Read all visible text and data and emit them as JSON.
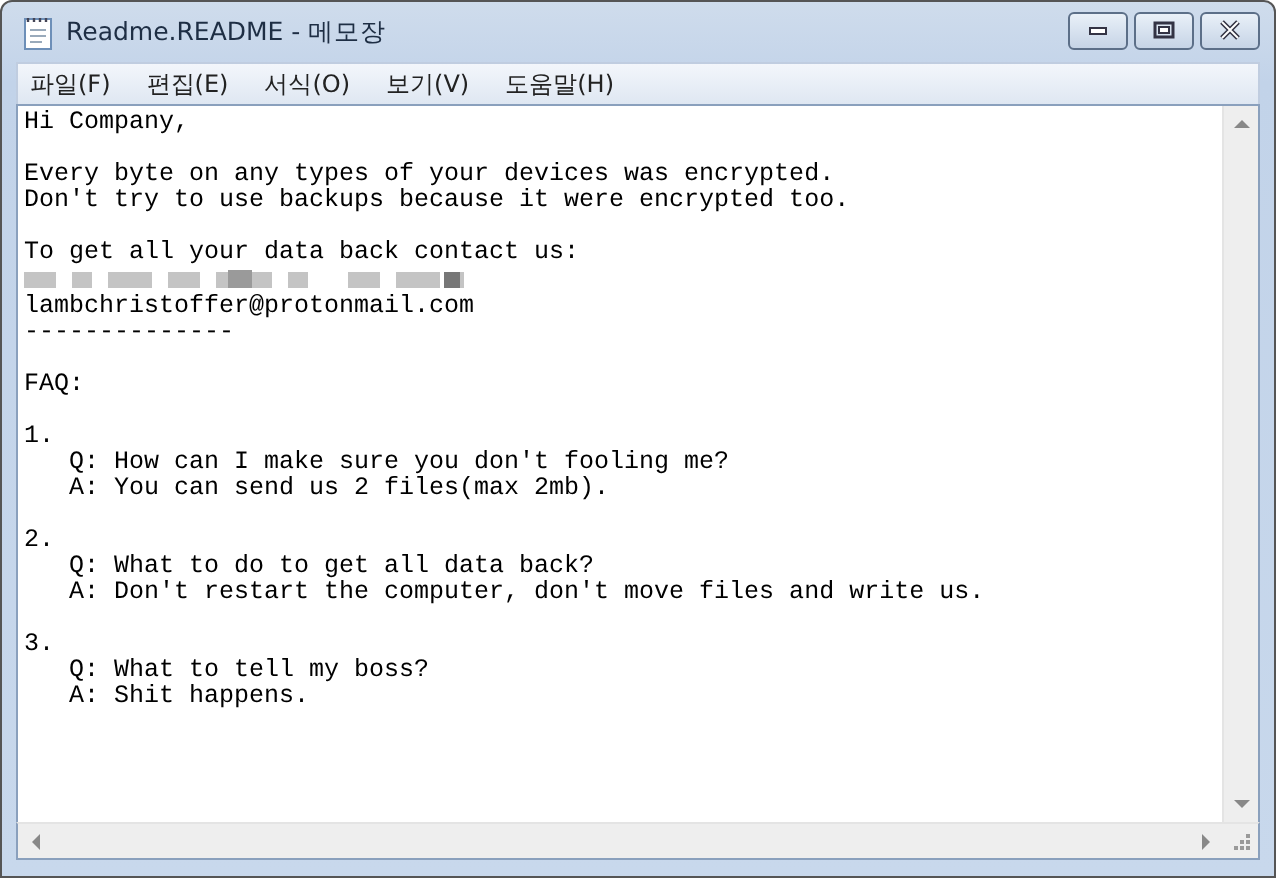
{
  "window": {
    "title": "Readme.README - 메모장"
  },
  "menu": [
    "파일(F)",
    "편집(E)",
    "서식(O)",
    "보기(V)",
    "도움말(H)"
  ],
  "document": {
    "blocks": [
      [
        {
          "kind": "text",
          "text": "Hi Company,"
        }
      ],
      [
        {
          "kind": "text",
          "text": "Every byte on any types of your devices was encrypted."
        },
        {
          "kind": "text",
          "text": "Don't try to use backups because it were encrypted too."
        }
      ],
      [
        {
          "kind": "text",
          "text": "To get all your data back contact us:"
        },
        {
          "kind": "redacted"
        },
        {
          "kind": "text",
          "text": "lambchristoffer@protonmail.com"
        },
        {
          "kind": "text",
          "text": "--------------"
        }
      ],
      [
        {
          "kind": "text",
          "text": "FAQ:"
        }
      ],
      [
        {
          "kind": "text",
          "text": "1."
        },
        {
          "kind": "text",
          "text": "   Q: How can I make sure you don't fooling me?"
        },
        {
          "kind": "text",
          "text": "   A: You can send us 2 files(max 2mb)."
        }
      ],
      [
        {
          "kind": "text",
          "text": "2."
        },
        {
          "kind": "text",
          "text": "   Q: What to do to get all data back?"
        },
        {
          "kind": "text",
          "text": "   A: Don't restart the computer, don't move files and write us."
        }
      ],
      [
        {
          "kind": "text",
          "text": "3."
        },
        {
          "kind": "text",
          "text": "   Q: What to tell my boss?"
        },
        {
          "kind": "text",
          "text": "   A: Shit happens."
        }
      ]
    ]
  }
}
